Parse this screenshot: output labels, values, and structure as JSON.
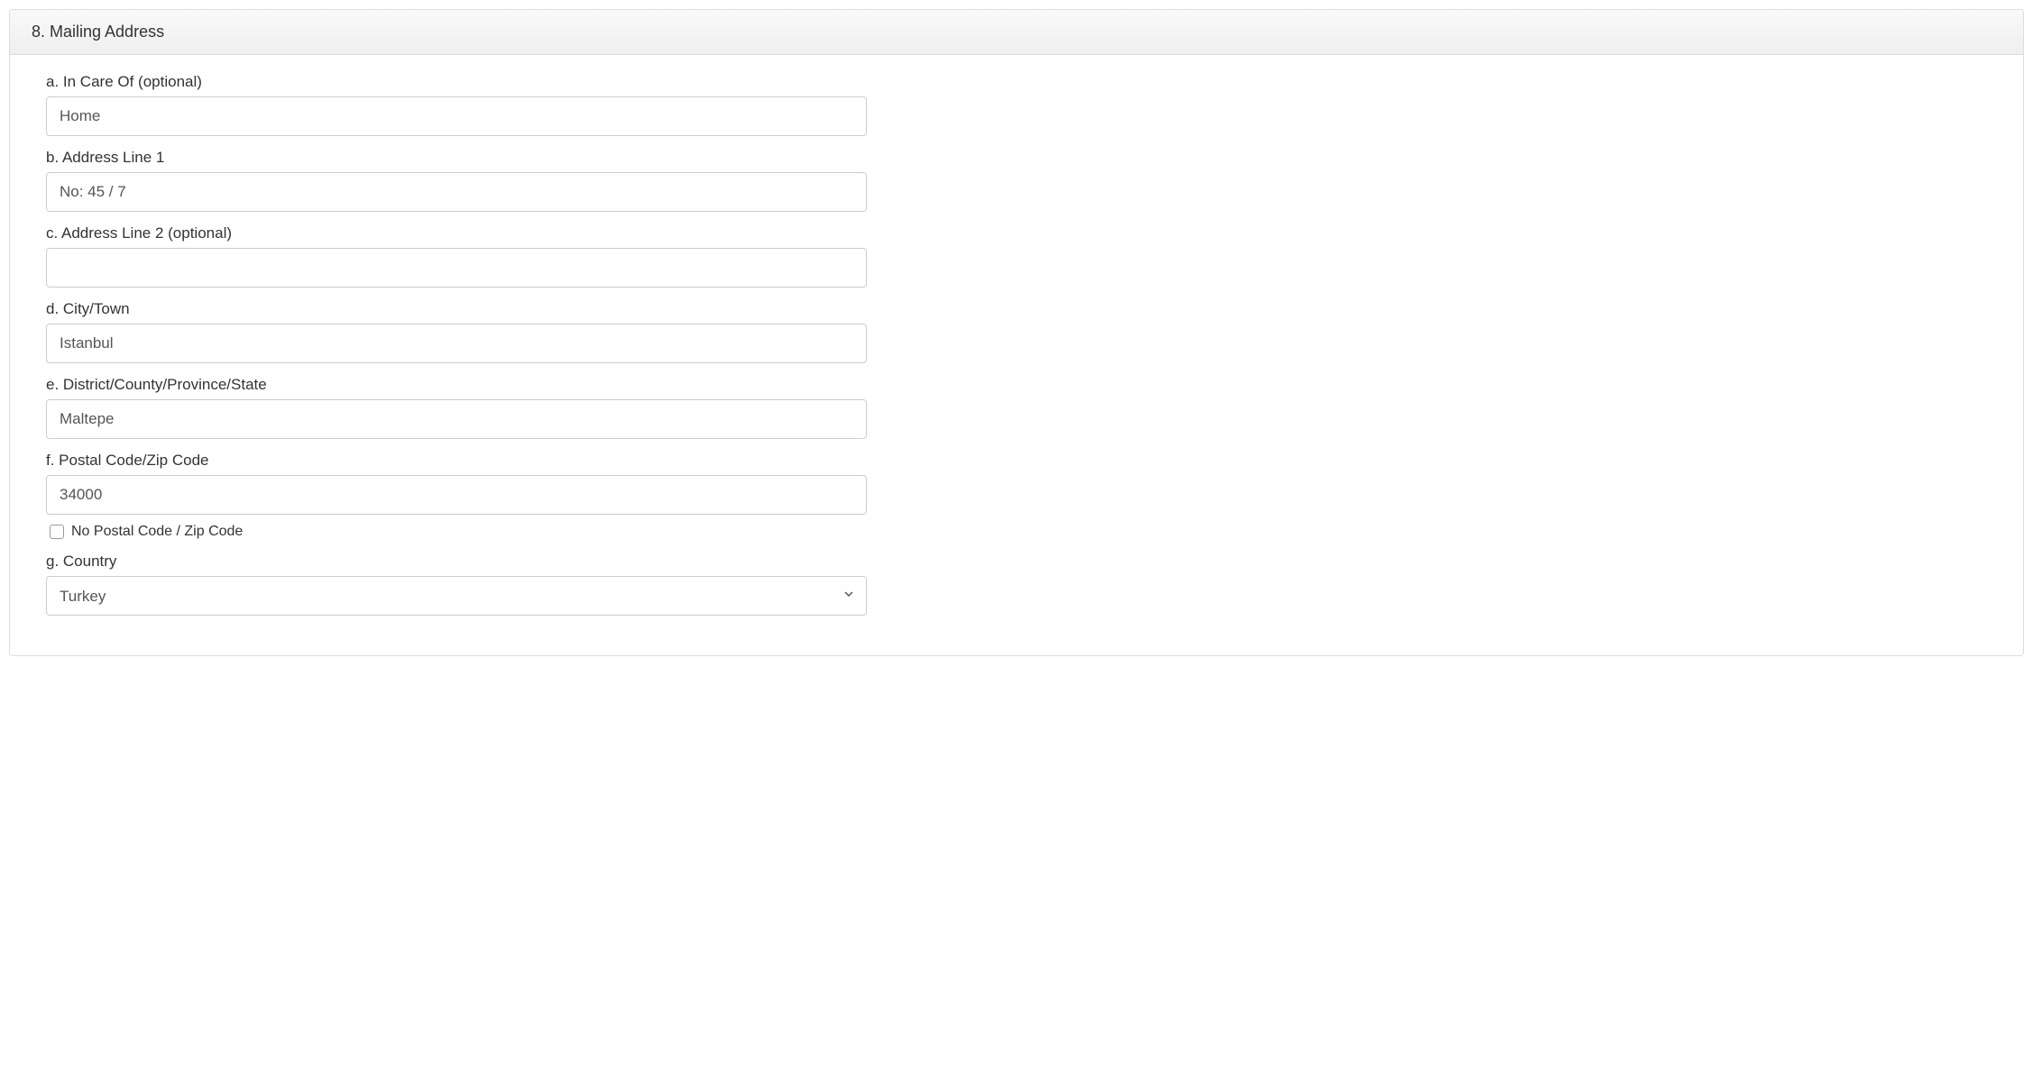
{
  "section": {
    "title": "8. Mailing Address"
  },
  "fields": {
    "in_care_of": {
      "label": "a. In Care Of (optional)",
      "value": "Home"
    },
    "address_line_1": {
      "label": "b. Address Line 1",
      "value": "No: 45 / 7"
    },
    "address_line_2": {
      "label": "c. Address Line 2 (optional)",
      "value": ""
    },
    "city": {
      "label": "d. City/Town",
      "value": "Istanbul"
    },
    "district": {
      "label": "e. District/County/Province/State",
      "value": "Maltepe"
    },
    "postal_code": {
      "label": "f. Postal Code/Zip Code",
      "value": "34000"
    },
    "no_postal_code": {
      "label": "No Postal Code / Zip Code",
      "checked": false
    },
    "country": {
      "label": "g. Country",
      "value": "Turkey"
    }
  }
}
